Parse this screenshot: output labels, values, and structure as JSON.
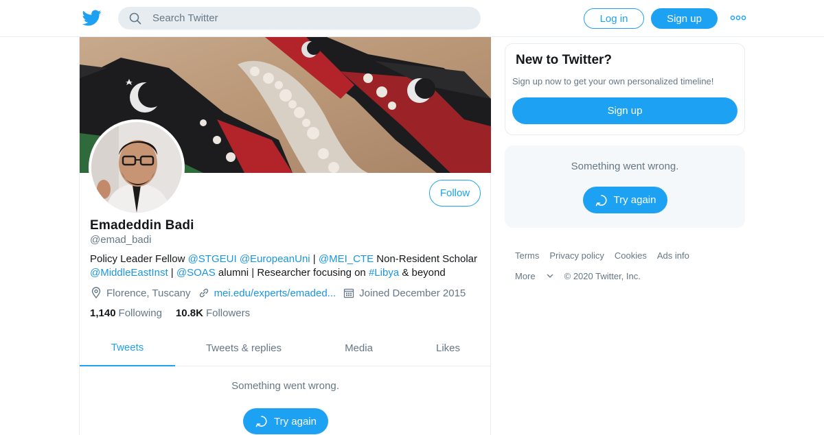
{
  "header": {
    "search_placeholder": "Search Twitter",
    "login_label": "Log in",
    "signup_label": "Sign up"
  },
  "profile": {
    "name": "Emadeddin Badi",
    "handle": "@emad_badi",
    "follow_label": "Follow",
    "bio": {
      "t1": "Policy Leader Fellow ",
      "m1": "@STGEUI",
      "t2": " ",
      "m2": "@EuropeanUni",
      "t3": " | ",
      "m3": "@MEI_CTE",
      "t4": " Non-Resident Scholar ",
      "m4": "@MiddleEastInst",
      "t5": " | ",
      "m5": "@SOAS",
      "t6": " alumni | Researcher focusing on ",
      "m6": "#Libya",
      "t7": " & beyond"
    },
    "location": "Florence, Tuscany",
    "url": "mei.edu/experts/emaded...",
    "joined": "Joined December 2015",
    "following_count": "1,140",
    "following_label": "Following",
    "followers_count": "10.8K",
    "followers_label": "Followers"
  },
  "tabs": [
    {
      "label": "Tweets",
      "active": true
    },
    {
      "label": "Tweets & replies",
      "active": false
    },
    {
      "label": "Media",
      "active": false
    },
    {
      "label": "Likes",
      "active": false
    }
  ],
  "timeline": {
    "error_text": "Something went wrong.",
    "retry_label": "Try again"
  },
  "sidebar": {
    "new_title": "New to Twitter?",
    "new_subtitle": "Sign up now to get your own personalized timeline!",
    "signup_label": "Sign up",
    "error_text": "Something went wrong.",
    "retry_label": "Try again"
  },
  "footer": {
    "links": [
      "Terms",
      "Privacy policy",
      "Cookies",
      "Ads info"
    ],
    "more_label": "More",
    "copyright": "© 2020 Twitter, Inc."
  },
  "colors": {
    "accent": "#1da1f2",
    "link": "#1b95e0",
    "muted": "#657786",
    "border": "#e6ecf0"
  },
  "icons": [
    "twitter-bird-icon",
    "search-icon",
    "more-dots-icon",
    "location-icon",
    "link-icon",
    "calendar-icon",
    "refresh-icon",
    "chevron-down-icon"
  ]
}
